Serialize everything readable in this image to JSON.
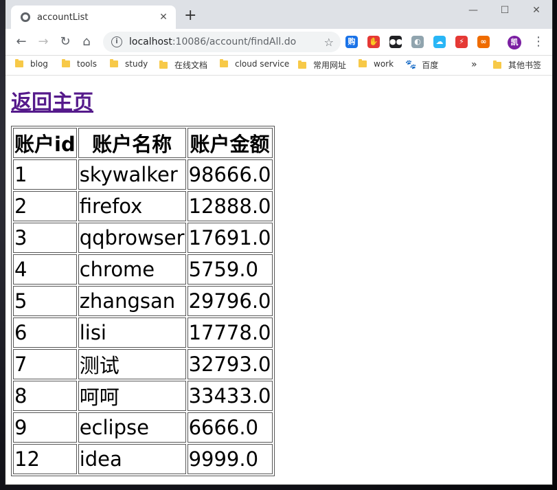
{
  "tab": {
    "title": "accountList",
    "close": "✕",
    "new_tab": "+"
  },
  "window_controls": {
    "minimize": "—",
    "maximize": "☐",
    "close": "✕"
  },
  "nav": {
    "back": "←",
    "forward": "→",
    "reload": "↻",
    "home": "⌂"
  },
  "address": {
    "host": "localhost",
    "path": ":10086/account/findAll.do",
    "info_icon": "i",
    "star": "☆"
  },
  "extensions": [
    {
      "label": "购",
      "color": "#1a73e8"
    },
    {
      "label": "✋",
      "color": "#e53935"
    },
    {
      "label": "●●",
      "color": "#202124"
    },
    {
      "label": "◐",
      "color": "#90a4ae"
    },
    {
      "label": "☁",
      "color": "#29b6f6"
    },
    {
      "label": "⚡",
      "color": "#e53935"
    },
    {
      "label": "∞",
      "color": "#ef6c00"
    }
  ],
  "profile": {
    "label": "凯",
    "color": "#7b1fa2"
  },
  "menu": "⋮",
  "bookmarks": {
    "items": [
      "blog",
      "tools",
      "study",
      "在线文档",
      "cloud service",
      "常用网址",
      "work",
      "百度"
    ],
    "overflow": "»",
    "other": "其他书签"
  },
  "page": {
    "home_link": "返回主页"
  },
  "table": {
    "headers": [
      "账户id",
      "账户名称",
      "账户金额"
    ],
    "rows": [
      [
        "1",
        "skywalker",
        "98666.0"
      ],
      [
        "2",
        "firefox",
        "12888.0"
      ],
      [
        "3",
        "qqbrowser",
        "17691.0"
      ],
      [
        "4",
        "chrome",
        "5759.0"
      ],
      [
        "5",
        "zhangsan",
        "29796.0"
      ],
      [
        "6",
        "lisi",
        "17778.0"
      ],
      [
        "7",
        "测试",
        "32793.0"
      ],
      [
        "8",
        "呵呵",
        "33433.0"
      ],
      [
        "9",
        "eclipse",
        "6666.0"
      ],
      [
        "12",
        "idea",
        "9999.0"
      ]
    ]
  }
}
